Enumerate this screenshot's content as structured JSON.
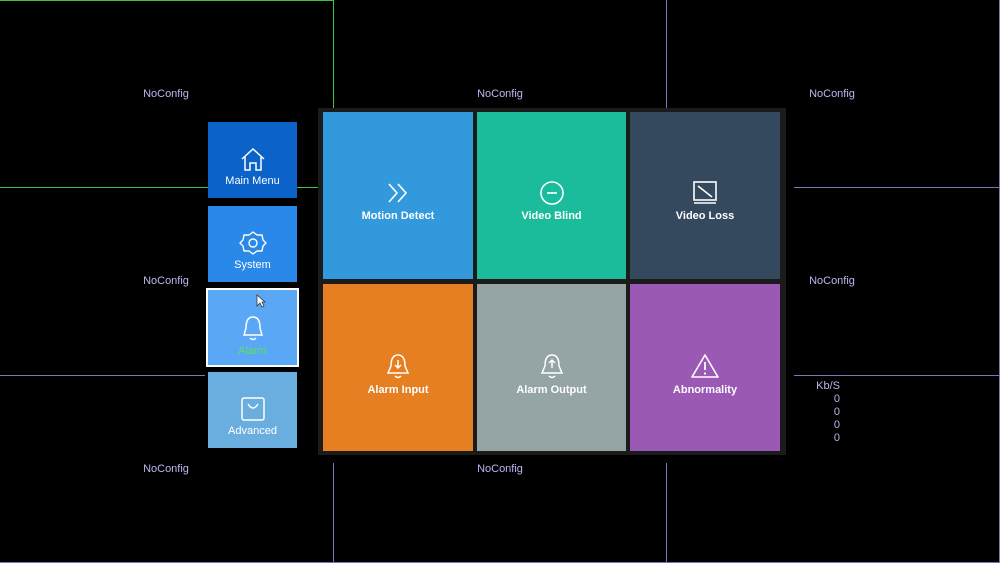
{
  "grid": {
    "cell_label": "NoConfig",
    "line_color": "#7878b8",
    "selected_color": "#3cc43c"
  },
  "sidebar": {
    "items": [
      {
        "label": "Main Menu",
        "icon": "home-icon",
        "color": "#0b63c9"
      },
      {
        "label": "System",
        "icon": "gear-icon",
        "color": "#2a88e8"
      },
      {
        "label": "Alarm",
        "icon": "bell-icon",
        "color": "#5aa8f5",
        "selected": true
      },
      {
        "label": "Advanced",
        "icon": "bag-icon",
        "color": "#6aaee0"
      }
    ]
  },
  "tiles": [
    {
      "label": "Motion Detect",
      "icon": "double-chevron-icon",
      "color": "#3399dd"
    },
    {
      "label": "Video Blind",
      "icon": "minus-circle-icon",
      "color": "#1bbc9b"
    },
    {
      "label": "Video Loss",
      "icon": "monitor-slash-icon",
      "color": "#34495e"
    },
    {
      "label": "Alarm Input",
      "icon": "bell-down-icon",
      "color": "#e67e22"
    },
    {
      "label": "Alarm Output",
      "icon": "bell-up-icon",
      "color": "#95a5a6"
    },
    {
      "label": "Abnormality",
      "icon": "warning-icon",
      "color": "#9b59b6"
    }
  ],
  "bitrate": {
    "header": "Kb/S",
    "values": [
      "0",
      "0",
      "0",
      "0"
    ]
  }
}
